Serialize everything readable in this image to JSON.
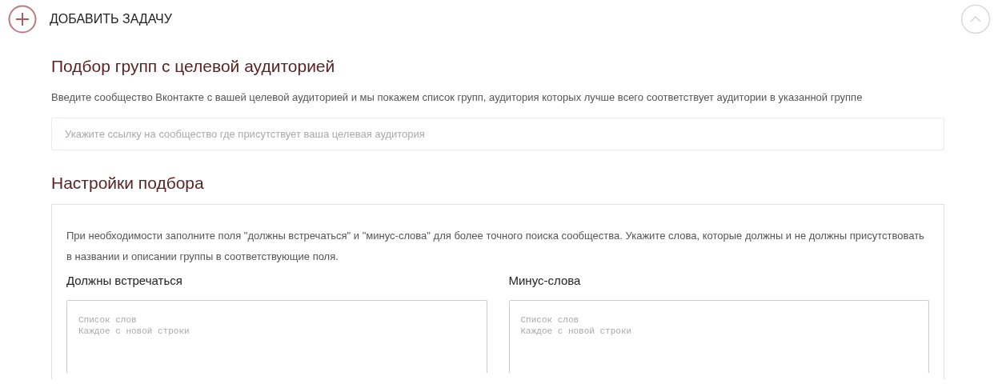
{
  "header": {
    "title": "ДОБАВИТЬ ЗАДАЧУ",
    "expanded": true
  },
  "audience": {
    "title": "Подбор групп с целевой аудиторией",
    "description": "Введите сообщество Вконтакте с вашей целевой аудиторией и мы покажем список групп, аудитория которых лучше всего соответствует аудитории в указанной группе",
    "placeholder": "Укажите ссылку на сообщество где присутствует ваша целевая аудитория"
  },
  "settings": {
    "title": "Настройки подбора",
    "description": "При необходимости заполните поля \"должны встречаться\" и \"минус-слова\" для более точного поиска сообщества. Укажите слова, которые должны и не должны присутствовать в названии и описании группы в соответствующие поля.",
    "fields": [
      {
        "label": "Должны встречаться",
        "placeholder": "Список слов\nКаждое с новой строки"
      },
      {
        "label": "Минус-слова",
        "placeholder": "Список слов\nКаждое с новой строки"
      }
    ]
  }
}
